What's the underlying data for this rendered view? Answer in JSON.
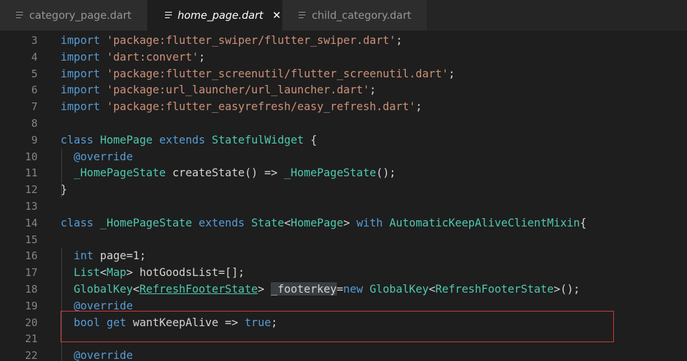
{
  "tabs": [
    {
      "label": "category_page.dart",
      "active": false,
      "icon": "file-lines-icon"
    },
    {
      "label": "home_page.dart",
      "active": true,
      "icon": "file-lines-icon",
      "close": "✕"
    },
    {
      "label": "child_category.dart",
      "active": false,
      "icon": "file-lines-icon"
    }
  ],
  "colors": {
    "keyword": "#569cd6",
    "string": "#ce9178",
    "type": "#4ec9b0",
    "plain": "#d4d4d4",
    "line_number": "#858585",
    "highlight_border": "#d13b3b"
  },
  "editor": {
    "lines": [
      {
        "n": "3",
        "tokens": [
          [
            "k",
            "import"
          ],
          [
            "p",
            " "
          ],
          [
            "s",
            "'package:flutter_swiper/flutter_swiper.dart'"
          ],
          [
            "p",
            ";"
          ]
        ]
      },
      {
        "n": "4",
        "tokens": [
          [
            "k",
            "import"
          ],
          [
            "p",
            " "
          ],
          [
            "s",
            "'dart:convert'"
          ],
          [
            "p",
            ";"
          ]
        ]
      },
      {
        "n": "5",
        "tokens": [
          [
            "k",
            "import"
          ],
          [
            "p",
            " "
          ],
          [
            "s",
            "'package:flutter_screenutil/flutter_screenutil.dart'"
          ],
          [
            "p",
            ";"
          ]
        ]
      },
      {
        "n": "6",
        "tokens": [
          [
            "k",
            "import"
          ],
          [
            "p",
            " "
          ],
          [
            "s",
            "'package:url_launcher/url_launcher.dart'"
          ],
          [
            "p",
            ";"
          ]
        ]
      },
      {
        "n": "7",
        "tokens": [
          [
            "k",
            "import"
          ],
          [
            "p",
            " "
          ],
          [
            "s",
            "'package:flutter_easyrefresh/easy_refresh.dart'"
          ],
          [
            "p",
            ";"
          ]
        ]
      },
      {
        "n": "8",
        "tokens": []
      },
      {
        "n": "9",
        "tokens": [
          [
            "k",
            "class"
          ],
          [
            "p",
            " "
          ],
          [
            "t",
            "HomePage"
          ],
          [
            "p",
            " "
          ],
          [
            "k",
            "extends"
          ],
          [
            "p",
            " "
          ],
          [
            "t",
            "StatefulWidget"
          ],
          [
            "p",
            " {"
          ]
        ]
      },
      {
        "n": "10",
        "tokens": [
          [
            "p",
            "  "
          ],
          [
            "a",
            "@override"
          ]
        ]
      },
      {
        "n": "11",
        "tokens": [
          [
            "p",
            "  "
          ],
          [
            "t",
            "_HomePageState"
          ],
          [
            "p",
            " createState() => "
          ],
          [
            "t",
            "_HomePageState"
          ],
          [
            "p",
            "();"
          ]
        ]
      },
      {
        "n": "12",
        "tokens": [
          [
            "p",
            "}"
          ]
        ]
      },
      {
        "n": "13",
        "tokens": []
      },
      {
        "n": "14",
        "tokens": [
          [
            "k",
            "class"
          ],
          [
            "p",
            " "
          ],
          [
            "t",
            "_HomePageState"
          ],
          [
            "p",
            " "
          ],
          [
            "k",
            "extends"
          ],
          [
            "p",
            " "
          ],
          [
            "t",
            "State"
          ],
          [
            "p",
            "<"
          ],
          [
            "t",
            "HomePage"
          ],
          [
            "p",
            "> "
          ],
          [
            "k",
            "with"
          ],
          [
            "p",
            " "
          ],
          [
            "t",
            "AutomaticKeepAliveClientMixin"
          ],
          [
            "p",
            "{"
          ]
        ]
      },
      {
        "n": "15",
        "tokens": []
      },
      {
        "n": "16",
        "tokens": [
          [
            "p",
            "  "
          ],
          [
            "k",
            "int"
          ],
          [
            "p",
            " page=1;"
          ]
        ]
      },
      {
        "n": "17",
        "tokens": [
          [
            "p",
            "  "
          ],
          [
            "t",
            "List"
          ],
          [
            "p",
            "<"
          ],
          [
            "t",
            "Map"
          ],
          [
            "p",
            "> hotGoodsList=[];"
          ]
        ]
      },
      {
        "n": "18",
        "tokens": [
          [
            "p",
            "  "
          ],
          [
            "t",
            "GlobalKey"
          ],
          [
            "p",
            "<"
          ],
          [
            "tu",
            "RefreshFooterState"
          ],
          [
            "p",
            "> "
          ],
          [
            "ph",
            "_footerkey"
          ],
          [
            "p",
            "="
          ],
          [
            "k",
            "new"
          ],
          [
            "p",
            " "
          ],
          [
            "t",
            "GlobalKey"
          ],
          [
            "p",
            "<"
          ],
          [
            "t",
            "RefreshFooterState"
          ],
          [
            "p",
            ">();"
          ]
        ]
      },
      {
        "n": "19",
        "tokens": [
          [
            "p",
            "  "
          ],
          [
            "a",
            "@override"
          ]
        ]
      },
      {
        "n": "20",
        "tokens": [
          [
            "p",
            "  "
          ],
          [
            "k",
            "bool"
          ],
          [
            "p",
            " "
          ],
          [
            "k",
            "get"
          ],
          [
            "p",
            " wantKeepAlive => "
          ],
          [
            "k",
            "true"
          ],
          [
            "p",
            ";"
          ]
        ]
      },
      {
        "n": "21",
        "tokens": []
      },
      {
        "n": "22",
        "tokens": [
          [
            "p",
            "  "
          ],
          [
            "a",
            "@override"
          ]
        ]
      }
    ]
  }
}
